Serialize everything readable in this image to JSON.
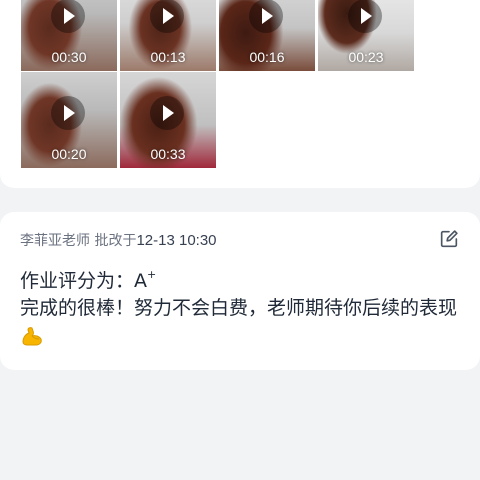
{
  "videos": [
    {
      "duration": "00:30"
    },
    {
      "duration": "00:13"
    },
    {
      "duration": "00:16"
    },
    {
      "duration": "00:23"
    },
    {
      "duration": "00:20"
    },
    {
      "duration": "00:33"
    }
  ],
  "comment": {
    "teacher": "李菲亚老师",
    "action": "批改于",
    "time": "12-13 10:30",
    "grade_label": "作业评分为：",
    "grade": "A",
    "grade_plus": "+",
    "text": "完成的很棒！努力不会白费，老师期待你后续的表现",
    "emoji_icon": "flexed-biceps-icon",
    "edit_icon": "edit-icon"
  },
  "colors": {
    "background": "#f2f3f5",
    "card": "#ffffff",
    "meta_text": "#6b7280",
    "body_text": "#1f2937"
  }
}
